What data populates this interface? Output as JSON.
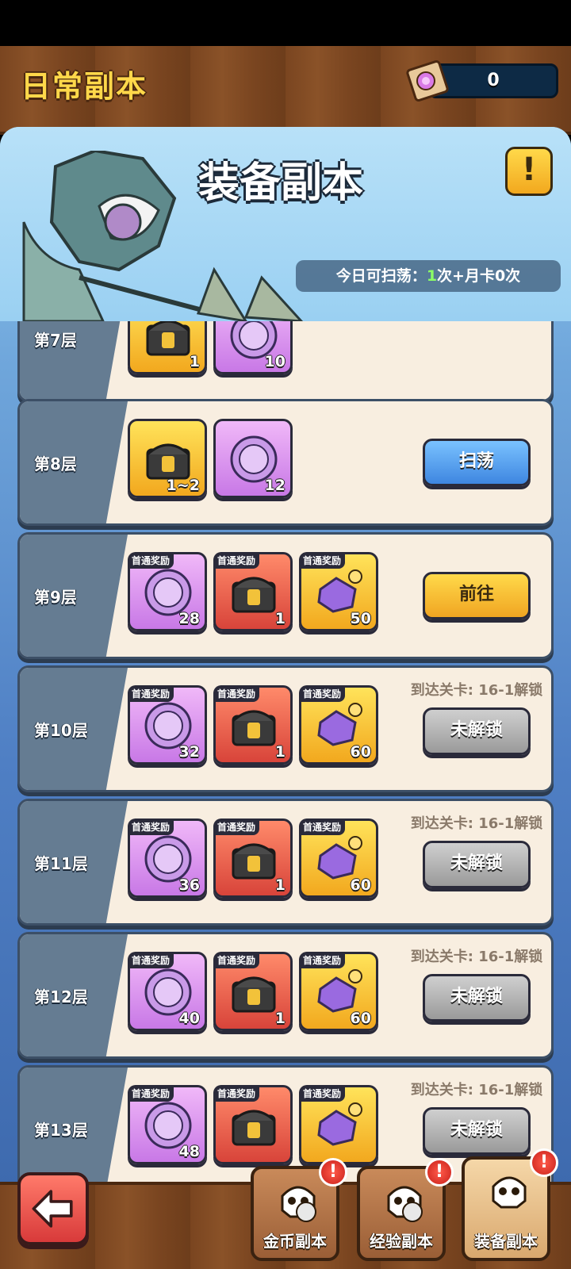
{
  "header": {
    "title": "日常副本",
    "currency_value": "0"
  },
  "banner": {
    "title": "装备副本",
    "info_icon": "exclamation-icon",
    "sweep_prefix": "今日可扫荡：",
    "sweep_count": "1",
    "sweep_suffix": "次+月卡0次"
  },
  "colors": {
    "accent_gold": "#ffd84a",
    "sweep_blue": "#3e86e0",
    "goto_yellow": "#f0a522",
    "locked_grey": "#9a9a9a",
    "count_green": "#8cff66"
  },
  "floors": [
    {
      "label": "第7层",
      "rewards": [
        {
          "type": "gold",
          "icon": "chest-icon",
          "tag": "",
          "count": "1"
        },
        {
          "type": "purple",
          "icon": "coin-icon",
          "tag": "",
          "count": "10"
        }
      ],
      "action": "",
      "action_style": "",
      "note": ""
    },
    {
      "label": "第8层",
      "rewards": [
        {
          "type": "gold",
          "icon": "chest-icon",
          "tag": "",
          "count": "1~2"
        },
        {
          "type": "purple",
          "icon": "coin-icon",
          "tag": "",
          "count": "12"
        }
      ],
      "action": "扫荡",
      "action_style": "blue",
      "note": ""
    },
    {
      "label": "第9层",
      "rewards": [
        {
          "type": "purple",
          "icon": "coin-icon",
          "tag": "首通奖励",
          "count": "28"
        },
        {
          "type": "red",
          "icon": "chest-icon",
          "tag": "首通奖励",
          "count": "1"
        },
        {
          "type": "gold",
          "icon": "puzzle-icon",
          "tag": "首通奖励",
          "count": "50"
        }
      ],
      "action": "前往",
      "action_style": "yellow",
      "note": ""
    },
    {
      "label": "第10层",
      "rewards": [
        {
          "type": "purple",
          "icon": "coin-icon",
          "tag": "首通奖励",
          "count": "32"
        },
        {
          "type": "red",
          "icon": "chest-icon",
          "tag": "首通奖励",
          "count": "1"
        },
        {
          "type": "gold",
          "icon": "puzzle-icon",
          "tag": "首通奖励",
          "count": "60"
        }
      ],
      "action": "未解锁",
      "action_style": "grey",
      "note": "到达关卡: 16-1解锁"
    },
    {
      "label": "第11层",
      "rewards": [
        {
          "type": "purple",
          "icon": "coin-icon",
          "tag": "首通奖励",
          "count": "36"
        },
        {
          "type": "red",
          "icon": "chest-icon",
          "tag": "首通奖励",
          "count": "1"
        },
        {
          "type": "gold",
          "icon": "puzzle-icon",
          "tag": "首通奖励",
          "count": "60"
        }
      ],
      "action": "未解锁",
      "action_style": "grey",
      "note": "到达关卡: 16-1解锁"
    },
    {
      "label": "第12层",
      "rewards": [
        {
          "type": "purple",
          "icon": "coin-icon",
          "tag": "首通奖励",
          "count": "40"
        },
        {
          "type": "red",
          "icon": "chest-icon",
          "tag": "首通奖励",
          "count": "1"
        },
        {
          "type": "gold",
          "icon": "puzzle-icon",
          "tag": "首通奖励",
          "count": "60"
        }
      ],
      "action": "未解锁",
      "action_style": "grey",
      "note": "到达关卡: 16-1解锁"
    },
    {
      "label": "第13层",
      "rewards": [
        {
          "type": "purple",
          "icon": "coin-icon",
          "tag": "首通奖励",
          "count": "48"
        },
        {
          "type": "red",
          "icon": "chest-icon",
          "tag": "首通奖励",
          "count": ""
        },
        {
          "type": "gold",
          "icon": "puzzle-icon",
          "tag": "首通奖励",
          "count": ""
        }
      ],
      "action": "未解锁",
      "action_style": "grey",
      "note": "到达关卡: 16-1解锁"
    }
  ],
  "bottom_nav": {
    "back_icon": "back-arrow-icon",
    "tabs": [
      {
        "label": "金币副本",
        "icon": "skull-crown-icon",
        "badge": "!"
      },
      {
        "label": "经验副本",
        "icon": "skull-exp-icon",
        "badge": "!"
      },
      {
        "label": "装备副本",
        "icon": "skull-star-icon",
        "badge": "!"
      }
    ]
  }
}
